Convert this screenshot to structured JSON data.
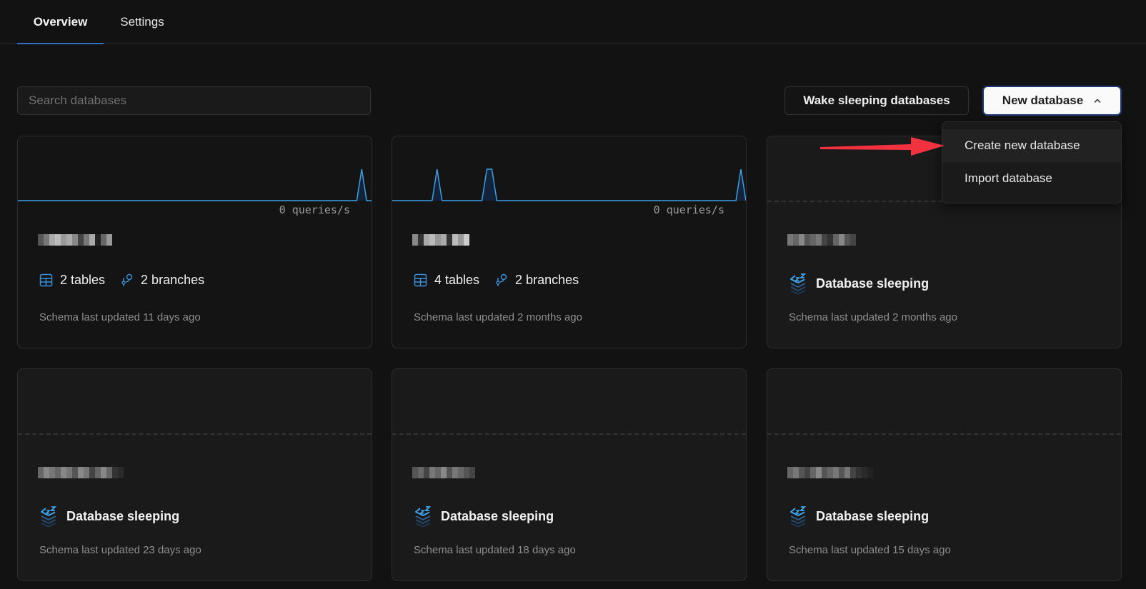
{
  "tabs": [
    {
      "label": "Overview",
      "active": true
    },
    {
      "label": "Settings",
      "active": false
    }
  ],
  "search": {
    "placeholder": "Search databases",
    "value": ""
  },
  "toolbar": {
    "wake_label": "Wake sleeping databases",
    "new_label": "New database",
    "new_icon": "chevron-up-icon"
  },
  "dropdown": {
    "items": [
      {
        "label": "Create new database",
        "highlighted": true
      },
      {
        "label": "Import database",
        "highlighted": false
      }
    ]
  },
  "annotation": {
    "type": "arrow",
    "color": "#f2323f",
    "points_to": "Create new database"
  },
  "colors": {
    "accent": "#3aa0e8",
    "background": "#121212",
    "card_active": "#141414",
    "card_sleeping": "#1a1a1a"
  },
  "databases": [
    {
      "name": "[redacted]",
      "status": "active",
      "qps_label": "0 queries/s",
      "activity": [
        0,
        0,
        0,
        0,
        0,
        0,
        0,
        0,
        0,
        0,
        0,
        0,
        0,
        0,
        0,
        0,
        0,
        0,
        0,
        0,
        0,
        0,
        0,
        0,
        0,
        0,
        0,
        0,
        0,
        0,
        0,
        0,
        0,
        0,
        0,
        0,
        0,
        0,
        0,
        0,
        0,
        0,
        0,
        0,
        0,
        0,
        0,
        0,
        0,
        0,
        0,
        0,
        0,
        0,
        0,
        0,
        0,
        0,
        0,
        0,
        0,
        0,
        0,
        0,
        0,
        0,
        0,
        0,
        0,
        0,
        1,
        0,
        0
      ],
      "tables_label": "2 tables",
      "branches_label": "2 branches",
      "updated": "Schema last updated 11 days ago"
    },
    {
      "name": "[redacted]",
      "status": "active",
      "qps_label": "0 queries/s",
      "activity": [
        0,
        0,
        0,
        0,
        0,
        0,
        0,
        0,
        0,
        1,
        0,
        0,
        0,
        0,
        0,
        0,
        0,
        0,
        0,
        1,
        1,
        0,
        0,
        0,
        0,
        0,
        0,
        0,
        0,
        0,
        0,
        0,
        0,
        0,
        0,
        0,
        0,
        0,
        0,
        0,
        0,
        0,
        0,
        0,
        0,
        0,
        0,
        0,
        0,
        0,
        0,
        0,
        0,
        0,
        0,
        0,
        0,
        0,
        0,
        0,
        0,
        0,
        0,
        0,
        0,
        0,
        0,
        0,
        0,
        0,
        1,
        0
      ],
      "tables_label": "4 tables",
      "branches_label": "2 branches",
      "updated": "Schema last updated 2 months ago"
    },
    {
      "name": "[redacted]",
      "status": "sleeping",
      "sleep_label": "Database sleeping",
      "updated": "Schema last updated 2 months ago"
    },
    {
      "name": "[redacted]",
      "status": "sleeping",
      "sleep_label": "Database sleeping",
      "updated": "Schema last updated 23 days ago"
    },
    {
      "name": "[redacted]",
      "status": "sleeping",
      "sleep_label": "Database sleeping",
      "updated": "Schema last updated 18 days ago"
    },
    {
      "name": "[redacted]",
      "status": "sleeping",
      "sleep_label": "Database sleeping",
      "updated": "Schema last updated 15 days ago"
    }
  ]
}
